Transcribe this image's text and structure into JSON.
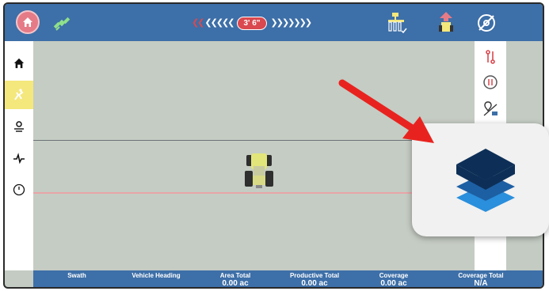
{
  "topbar": {
    "home_icon": "home-icon",
    "gps_icon": "satellite-icon",
    "offset_value": "3' 6\"",
    "implement_icon": "implement-icon",
    "tractor_icon": "tractor-icon",
    "steering_icon": "steering-disabled-icon"
  },
  "sidebar": {
    "items": [
      {
        "icon": "home-icon"
      },
      {
        "icon": "guidance-icon",
        "active": true
      },
      {
        "icon": "field-settings-icon"
      },
      {
        "icon": "diagnostics-icon"
      },
      {
        "icon": "speedometer-icon"
      }
    ]
  },
  "rightbar": {
    "items": [
      {
        "icon": "guideline-icon"
      },
      {
        "icon": "rotate-view-icon"
      },
      {
        "icon": "map-pin-icon"
      }
    ]
  },
  "bottombar": {
    "metrics": [
      {
        "label": "Swath",
        "value": ""
      },
      {
        "label": "Vehicle Heading",
        "value": ""
      },
      {
        "label": "Area Total",
        "value": "0.00 ac"
      },
      {
        "label": "Productive Total",
        "value": "0.00 ac"
      },
      {
        "label": "Coverage",
        "value": "0.00 ac"
      },
      {
        "label": "Coverage Total",
        "value": "N/A"
      }
    ]
  },
  "callout": {
    "icon": "layers-icon"
  },
  "colors": {
    "topbar": "#3d6fa8",
    "accent_red": "#d9494f",
    "active_item": "#f4e77c",
    "map": "#c5ccc3",
    "layers_dark": "#0d2f57",
    "layers_mid": "#1d5fa3",
    "layers_light": "#2a8fdc"
  }
}
